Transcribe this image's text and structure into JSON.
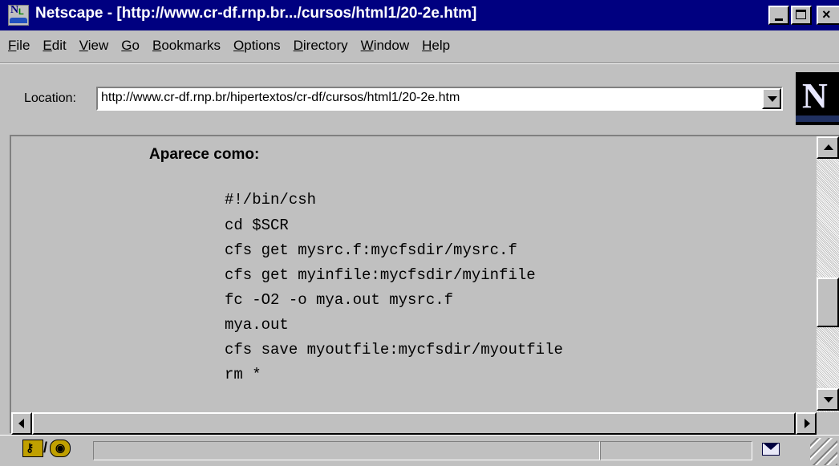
{
  "window": {
    "title": "Netscape - [http://www.cr-df.rnp.br.../cursos/html1/20-2e.htm]",
    "icon": "netscape-n-icon"
  },
  "menu": {
    "items": [
      {
        "label": "File",
        "key": "F",
        "rest": "ile"
      },
      {
        "label": "Edit",
        "key": "E",
        "rest": "dit"
      },
      {
        "label": "View",
        "key": "V",
        "rest": "iew"
      },
      {
        "label": "Go",
        "key": "G",
        "rest": "o"
      },
      {
        "label": "Bookmarks",
        "key": "B",
        "rest": "ookmarks"
      },
      {
        "label": "Options",
        "key": "O",
        "rest": "ptions"
      },
      {
        "label": "Directory",
        "key": "D",
        "rest": "irectory"
      },
      {
        "label": "Window",
        "key": "W",
        "rest": "indow"
      },
      {
        "label": "Help",
        "key": "H",
        "rest": "elp"
      }
    ]
  },
  "location": {
    "label": "Location:",
    "url": "http://www.cr-df.rnp.br/hipertextos/cr-df/cursos/html1/20-2e.htm"
  },
  "logo": {
    "letter": "N"
  },
  "content": {
    "heading": "Aparece como:",
    "code": [
      "#!/bin/csh",
      "cd $SCR",
      "cfs get mysrc.f:mycfsdir/mysrc.f",
      "cfs get myinfile:mycfsdir/myinfile",
      "fc -O2 -o mya.out mysrc.f",
      "mya.out",
      "cfs save myoutfile:mycfsdir/myoutfile",
      "rm *"
    ]
  },
  "statusbar": {
    "security_icon": "key-lock-icon",
    "mail_icon": "envelope-icon"
  }
}
